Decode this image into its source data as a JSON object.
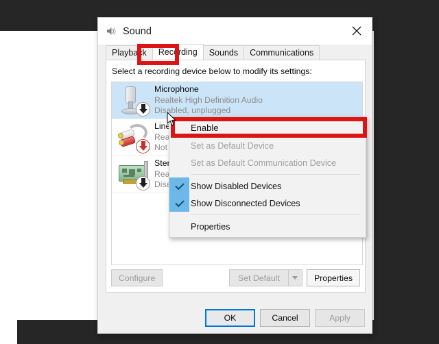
{
  "window": {
    "title": "Sound",
    "title_icon": "speaker-icon",
    "close_label": "✕"
  },
  "tabs": [
    {
      "label": "Playback",
      "active": false
    },
    {
      "label": "Recording",
      "active": true
    },
    {
      "label": "Sounds",
      "active": false
    },
    {
      "label": "Communications",
      "active": false
    }
  ],
  "panel": {
    "instruction": "Select a recording device below to modify its settings:"
  },
  "devices": [
    {
      "name": "Microphone",
      "driver": "Realtek High Definition Audio",
      "status": "Disabled, unplugged",
      "icon": "microphone-icon",
      "badge": "disabled-down-arrow-badge",
      "selected": true
    },
    {
      "name": "Line",
      "driver": "Rea",
      "status": "Not",
      "icon": "line-in-rca-icon",
      "badge": "unplugged-red-down-arrow-badge",
      "selected": false
    },
    {
      "name": "Ster",
      "driver": "Rea",
      "status": "Disa",
      "icon": "sound-card-icon",
      "badge": "disabled-down-arrow-badge",
      "selected": false
    }
  ],
  "mid_buttons": {
    "configure": {
      "label": "Configure",
      "enabled": false
    },
    "set_default": {
      "label": "Set Default",
      "enabled": false
    },
    "properties": {
      "label": "Properties",
      "enabled": true
    }
  },
  "dialog_buttons": {
    "ok": {
      "label": "OK",
      "enabled": true,
      "focused": true
    },
    "cancel": {
      "label": "Cancel",
      "enabled": true,
      "focused": false
    },
    "apply": {
      "label": "Apply",
      "enabled": false,
      "focused": false
    }
  },
  "context_menu": {
    "items": [
      {
        "label": "Enable",
        "enabled": true,
        "checked": false
      },
      {
        "label": "Set as Default Device",
        "enabled": false,
        "checked": false
      },
      {
        "label": "Set as Default Communication Device",
        "enabled": false,
        "checked": false
      },
      {
        "label": "Show Disabled Devices",
        "enabled": true,
        "checked": true
      },
      {
        "label": "Show Disconnected Devices",
        "enabled": true,
        "checked": true
      },
      {
        "label": "Properties",
        "enabled": true,
        "checked": false
      }
    ]
  },
  "annotations": {
    "highlight_color": "#dd1414",
    "targets": [
      "Recording",
      "Enable"
    ]
  },
  "colors": {
    "selection_blue": "#cce4f7",
    "check_strip_blue": "#6cb8e8",
    "focus_blue": "#0078d7",
    "backdrop_dark": "#262626"
  }
}
